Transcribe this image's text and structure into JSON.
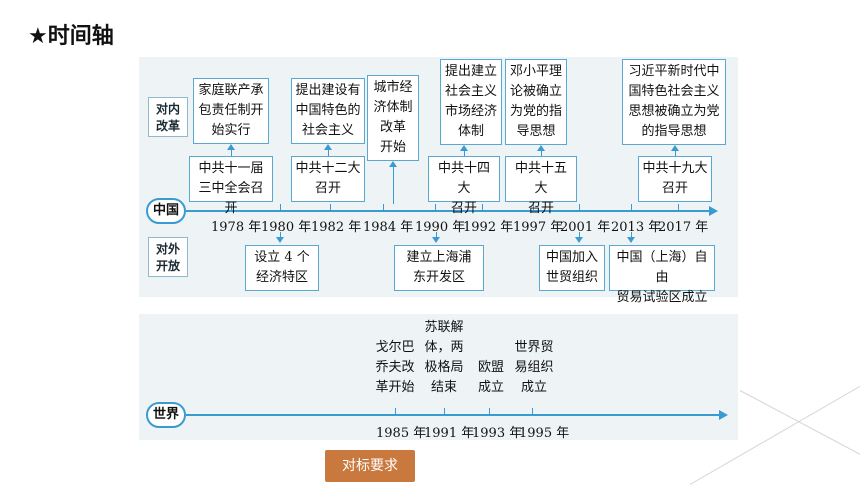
{
  "page": {
    "title": "★时间轴"
  },
  "china": {
    "axis_label": "中国",
    "domestic_label": [
      "对内",
      "改革"
    ],
    "foreign_label": [
      "对外",
      "开放"
    ],
    "years": [
      "1978 年",
      "1980 年",
      "1982 年",
      "1984 年",
      "1990 年",
      "1992 年",
      "1997 年",
      "2001 年",
      "2013 年",
      "2017 年"
    ],
    "meetings": [
      [
        "中共十一届",
        "三中全会召开"
      ],
      [
        "中共十二大",
        "召开"
      ],
      [
        "中共十四大",
        "召开"
      ],
      [
        "中共十五大",
        "召开"
      ],
      [
        "中共十九大",
        "召开"
      ]
    ],
    "reforms": [
      [
        "家庭联产承",
        "包责任制开",
        "始实行"
      ],
      [
        "提出建设有",
        "中国特色的",
        "社会主义"
      ],
      [
        "城市经",
        "济体制",
        "改革",
        "开始"
      ],
      [
        "提出建立",
        "社会主义",
        "市场经济",
        "体制"
      ],
      [
        "邓小平理",
        "论被确立",
        "为党的指",
        "导思想"
      ],
      [
        "习近平新时代中",
        "国特色社会主义",
        "思想被确立为党",
        "的指导思想"
      ]
    ],
    "opening": [
      [
        "设立 4 个",
        "经济特区"
      ],
      [
        "建立上海浦",
        "东开发区"
      ],
      [
        "中国加入",
        "世贸组织"
      ],
      [
        "中国（上海）自由",
        "贸易试验区成立"
      ]
    ]
  },
  "world": {
    "axis_label": "世界",
    "years": [
      "1985 年",
      "1991 年",
      "1993 年",
      "1995 年"
    ],
    "events": [
      [
        "戈尔巴",
        "乔夫改",
        "革开始"
      ],
      [
        "苏联解",
        "体，两",
        "极格局",
        "结束"
      ],
      [
        "欧盟",
        "成立"
      ],
      [
        "世界贸",
        "易组织",
        "成立"
      ]
    ]
  },
  "footer": {
    "button_label": "对标要求"
  },
  "colors": {
    "accent": "#3a9bd1",
    "panel": "#eef4f6",
    "button": "#c9783e"
  }
}
